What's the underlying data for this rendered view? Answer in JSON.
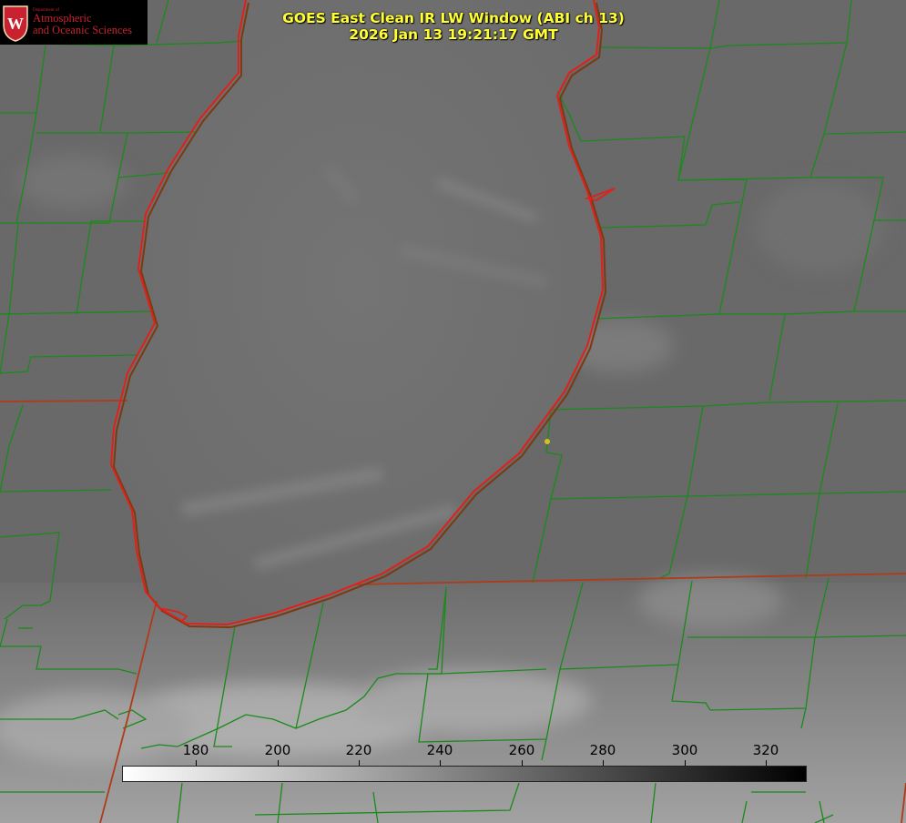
{
  "logo": {
    "department": "Department of",
    "line1": "Atmospheric",
    "line2": "and Oceanic Sciences",
    "seal_letter": "W"
  },
  "title": {
    "line1": "GOES East Clean IR LW Window (ABI ch 13)",
    "line2": "2026 Jan 13 19:21:17 GMT"
  },
  "colorbar": {
    "ticks": [
      "180",
      "200",
      "220",
      "240",
      "260",
      "280",
      "300",
      "320"
    ]
  },
  "colors": {
    "title": "#ffff33",
    "county_lines": "#1a8a1a",
    "state_lines": "#b03a1a",
    "lake_shore": "#e0201a",
    "logo_text": "#c9212f",
    "marker": "#d4c020"
  }
}
